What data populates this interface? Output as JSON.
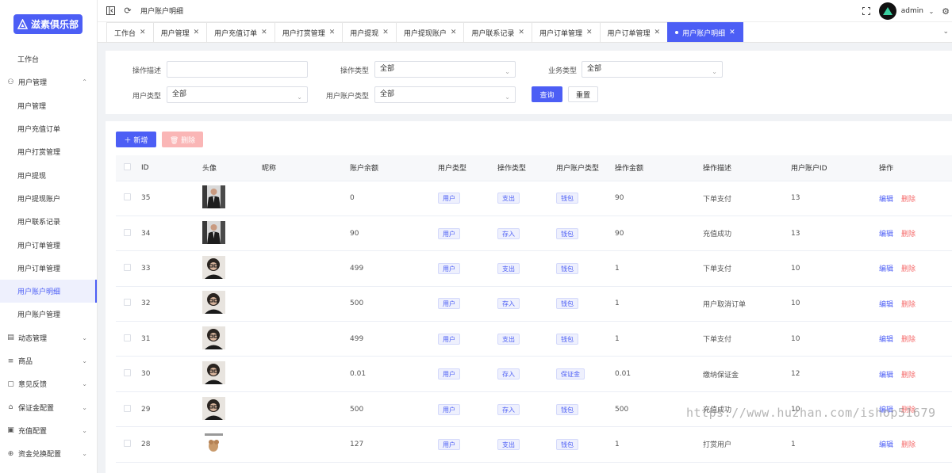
{
  "app": {
    "name": "滋素俱乐部"
  },
  "header": {
    "breadcrumb": "用户账户明细",
    "user": "admin"
  },
  "sidebar": {
    "items": [
      {
        "label": "工作台",
        "type": "item"
      },
      {
        "label": "用户管理",
        "type": "group",
        "icon": "user-icon",
        "expanded": true
      },
      {
        "label": "用户管理",
        "type": "item"
      },
      {
        "label": "用户充值订单",
        "type": "item"
      },
      {
        "label": "用户打赏管理",
        "type": "item"
      },
      {
        "label": "用户提现",
        "type": "item"
      },
      {
        "label": "用户提现账户",
        "type": "item"
      },
      {
        "label": "用户联系记录",
        "type": "item"
      },
      {
        "label": "用户订单管理",
        "type": "item"
      },
      {
        "label": "用户订单管理",
        "type": "item"
      },
      {
        "label": "用户账户明细",
        "type": "item",
        "active": true
      },
      {
        "label": "用户账户管理",
        "type": "item"
      },
      {
        "label": "动态管理",
        "type": "group",
        "icon": "document-icon"
      },
      {
        "label": "商品",
        "type": "group",
        "icon": "list-icon"
      },
      {
        "label": "意见反馈",
        "type": "group",
        "icon": "feedback-icon"
      },
      {
        "label": "保证金配置",
        "type": "group",
        "icon": "deposit-icon"
      },
      {
        "label": "充值配置",
        "type": "group",
        "icon": "recharge-icon"
      },
      {
        "label": "资金兑换配置",
        "type": "group",
        "icon": "exchange-icon"
      }
    ]
  },
  "tabs": [
    {
      "label": "工作台"
    },
    {
      "label": "用户管理"
    },
    {
      "label": "用户充值订单"
    },
    {
      "label": "用户打赏管理"
    },
    {
      "label": "用户提现"
    },
    {
      "label": "用户提现账户"
    },
    {
      "label": "用户联系记录"
    },
    {
      "label": "用户订单管理"
    },
    {
      "label": "用户订单管理"
    },
    {
      "label": "用户账户明细",
      "active": true
    }
  ],
  "search": {
    "op_desc_label": "操作描述",
    "op_desc_value": "",
    "op_type_label": "操作类型",
    "op_type_value": "全部",
    "biz_type_label": "业务类型",
    "biz_type_value": "全部",
    "user_type_label": "用户类型",
    "user_type_value": "全部",
    "acct_type_label": "用户账户类型",
    "acct_type_value": "全部",
    "query_label": "查询",
    "reset_label": "重置"
  },
  "toolbar": {
    "add_label": "新增",
    "delete_label": "删除"
  },
  "table": {
    "columns": [
      "ID",
      "头像",
      "昵称",
      "账户余额",
      "用户类型",
      "操作类型",
      "用户账户类型",
      "操作金额",
      "操作描述",
      "用户账户ID",
      "操作"
    ],
    "edit_label": "编辑",
    "delete_label": "删除",
    "rows": [
      {
        "id": "35",
        "avatar": "avatar-suit",
        "nickname": "",
        "balance": "0",
        "user_type": "用户",
        "op_type": "支出",
        "acct_type": "钱包",
        "amount": "90",
        "desc": "下单支付",
        "acct_id": "13"
      },
      {
        "id": "34",
        "avatar": "avatar-suit",
        "nickname": "",
        "balance": "90",
        "user_type": "用户",
        "op_type": "存入",
        "acct_type": "钱包",
        "amount": "90",
        "desc": "充值成功",
        "acct_id": "13"
      },
      {
        "id": "33",
        "avatar": "avatar-curly",
        "nickname": "",
        "balance": "499",
        "user_type": "用户",
        "op_type": "支出",
        "acct_type": "钱包",
        "amount": "1",
        "desc": "下单支付",
        "acct_id": "10"
      },
      {
        "id": "32",
        "avatar": "avatar-curly",
        "nickname": "",
        "balance": "500",
        "user_type": "用户",
        "op_type": "存入",
        "acct_type": "钱包",
        "amount": "1",
        "desc": "用户取消订单",
        "acct_id": "10"
      },
      {
        "id": "31",
        "avatar": "avatar-curly",
        "nickname": "",
        "balance": "499",
        "user_type": "用户",
        "op_type": "支出",
        "acct_type": "钱包",
        "amount": "1",
        "desc": "下单支付",
        "acct_id": "10"
      },
      {
        "id": "30",
        "avatar": "avatar-curly",
        "nickname": "",
        "balance": "0.01",
        "user_type": "用户",
        "op_type": "存入",
        "acct_type": "保证金",
        "amount": "0.01",
        "desc": "缴纳保证金",
        "acct_id": "12"
      },
      {
        "id": "29",
        "avatar": "avatar-curly",
        "nickname": "",
        "balance": "500",
        "user_type": "用户",
        "op_type": "存入",
        "acct_type": "钱包",
        "amount": "500",
        "desc": "充值成功",
        "acct_id": "10"
      },
      {
        "id": "28",
        "avatar": "avatar-cartoon",
        "nickname": "",
        "balance": "127",
        "user_type": "用户",
        "op_type": "支出",
        "acct_type": "钱包",
        "amount": "1",
        "desc": "打赏用户",
        "acct_id": "1"
      }
    ]
  },
  "watermark": "https://www.huzhan.com/ishop51679",
  "colors": {
    "accent": "#4c5ef5",
    "danger": "#f56c6c"
  }
}
